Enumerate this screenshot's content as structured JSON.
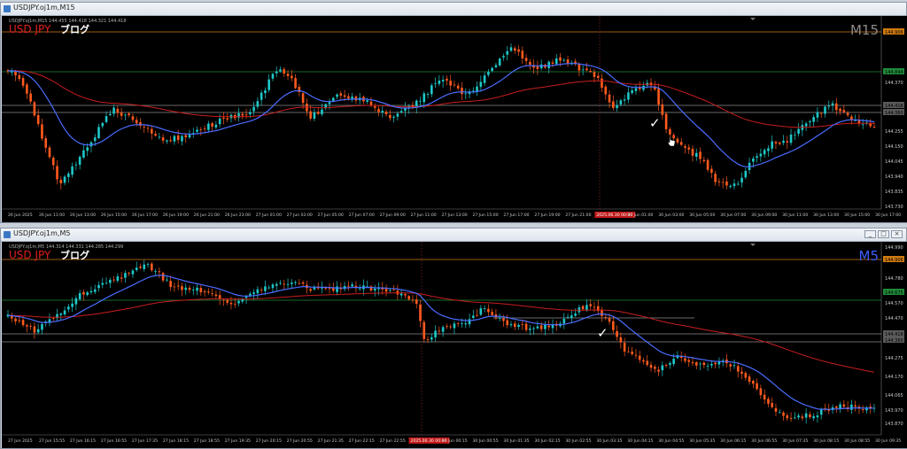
{
  "top": {
    "window_title": "USDJPY.oj1m,M15",
    "info_line": "USDJPY.oj1m,M15  144.455 144.418 144.321 144.418",
    "symbol_label": "USD JPY",
    "blog_label": "ブログ",
    "timeframe": "M15",
    "price_labels": [
      "144.906",
      "144.844",
      "144.370",
      "144.418",
      "144.360",
      "144.255",
      "144.150",
      "144.045",
      "143.940",
      "143.835",
      "143.730"
    ],
    "time_labels": [
      "26 Jun 2025",
      "26 Jun 11:00",
      "26 Jun 13:00",
      "26 Jun 15:00",
      "26 Jun 17:00",
      "26 Jun 19:00",
      "26 Jun 21:00",
      "26 Jun 23:00",
      "27 Jun 01:00",
      "27 Jun 03:00",
      "27 Jun 05:00",
      "27 Jun 07:00",
      "27 Jun 09:00",
      "27 Jun 11:00",
      "27 Jun 13:00",
      "27 Jun 15:00",
      "27 Jun 17:00",
      "27 Jun 19:00",
      "27 Jun 21:00",
      "2025.06.30 00:00",
      "30 Jun 01:00",
      "30 Jun 03:00",
      "30 Jun 05:00",
      "30 Jun 07:00",
      "30 Jun 09:00",
      "30 Jun 11:00",
      "30 Jun 13:00",
      "30 Jun 15:00",
      "30 Jun 17:00"
    ]
  },
  "bottom": {
    "window_title": "USDJPY.oj1m,M5",
    "info_line": "USDJPY.oj1m,M5  144.314 144.331 144.285 144.299",
    "symbol_label": "USD JPY",
    "blog_label": "ブログ",
    "timeframe": "M5",
    "price_labels": [
      "144.990",
      "144.906",
      "144.780",
      "144.675",
      "144.570",
      "144.470",
      "144.418",
      "144.360",
      "144.275",
      "144.170",
      "144.065",
      "143.970",
      "143.870"
    ],
    "time_labels": [
      "27 Jun 2025",
      "27 Jun 15:55",
      "27 Jun 16:15",
      "27 Jun 16:55",
      "27 Jun 17:35",
      "27 Jun 18:15",
      "27 Jun 18:55",
      "27 Jun 19:35",
      "27 Jun 20:15",
      "27 Jun 20:55",
      "27 Jun 21:35",
      "27 Jun 22:15",
      "27 Jun 22:55",
      "2025.06.30 00:00",
      "30 Jun 00:15",
      "30 Jun 00:55",
      "30 Jun 01:35",
      "30 Jun 02:15",
      "30 Jun 02:55",
      "30 Jun 03:35",
      "30 Jun 04:15",
      "30 Jun 04:55",
      "30 Jun 05:35",
      "30 Jun 06:15",
      "30 Jun 06:55",
      "30 Jun 07:35",
      "30 Jun 08:15",
      "30 Jun 08:55",
      "30 Jun 09:35"
    ]
  },
  "colors": {
    "bull": "#1ec8c8",
    "bear": "#ff5a1e",
    "ma_fast": "#4a6cff",
    "ma_slow": "#c81e1e",
    "hline_orange": "#d07a10",
    "hline_green": "#1f8a3a",
    "hline_grey": "#8c8c8c",
    "symbol": "#e02020",
    "tf_top": "#8a8a8a",
    "tf_bottom": "#3a5cff"
  },
  "icons": [
    "app-icon",
    "minimize-icon",
    "maximize-icon",
    "close-icon",
    "checkmark-icon",
    "hand-cursor-icon"
  ],
  "window_buttons": {
    "minimize": "_",
    "maximize": "□",
    "close": "×"
  },
  "checkmark": "✓"
}
